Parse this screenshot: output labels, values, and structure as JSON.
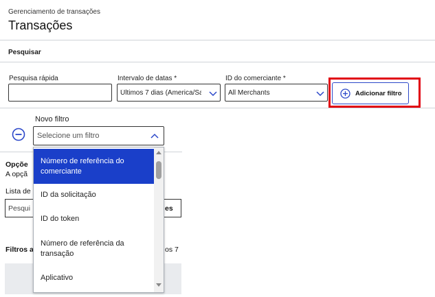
{
  "header": {
    "breadcrumb": "Gerenciamento de transações",
    "title": "Transações"
  },
  "search_section": {
    "label": "Pesquisar",
    "quick_search": {
      "label": "Pesquisa rápida",
      "value": ""
    },
    "date_range": {
      "label": "Intervalo de datas *",
      "value": "Últimos 7 dias (America/Sa"
    },
    "merchant_id": {
      "label": "ID do comerciante *",
      "value": "All Merchants"
    },
    "add_filter_label": "Adicionar filtro"
  },
  "new_filter": {
    "label": "Novo filtro",
    "placeholder": "Selecione um filtro",
    "options": [
      "Número de referência do comerciante",
      "ID da solicitação",
      "ID do token",
      "Número de referência da transação",
      "Aplicativo"
    ],
    "active_index": 0
  },
  "background": {
    "options_heading": "Opçõe",
    "options_sub": "A opçã",
    "list_label": "Lista de",
    "search_placeholder": "Pesqui",
    "search_suffix": "es",
    "filters_label": "Filtros a",
    "filters_suffix": "os 7"
  },
  "colors": {
    "accent": "#1a3fc9",
    "highlight_outline": "#e1000f"
  }
}
